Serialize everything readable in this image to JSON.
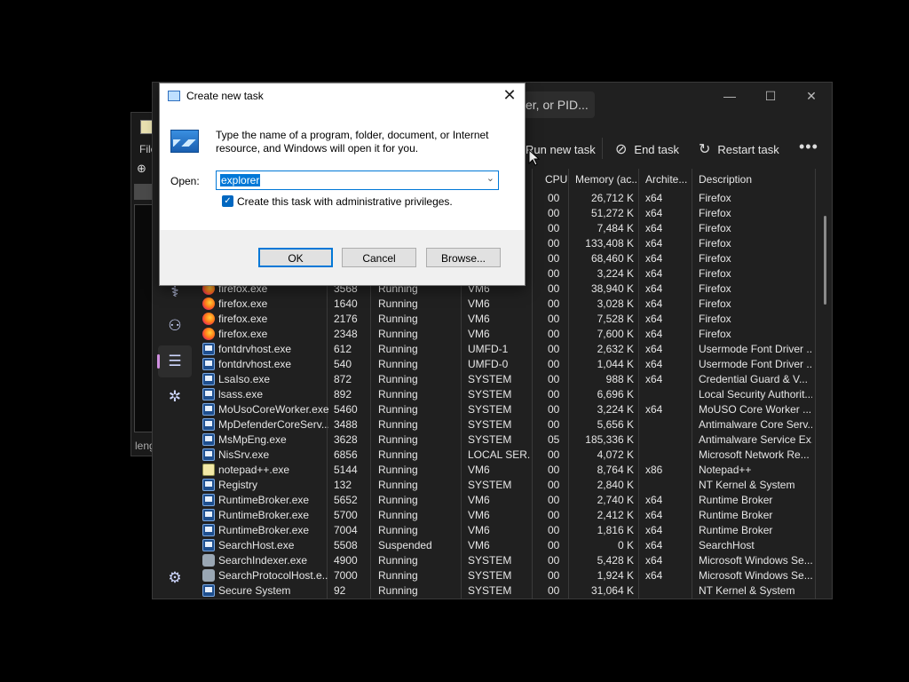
{
  "editor_window": {
    "menu_file": "File",
    "status_text": "leng"
  },
  "task_manager": {
    "search_placeholder": "er, or PID...",
    "window_controls": {
      "minimize": "—",
      "maximize": "☐",
      "close": "✕"
    },
    "commands": {
      "run_new_task": "Run new task",
      "end_task": "End task",
      "restart_task": "Restart task",
      "more": "•••"
    },
    "nav_icons": [
      "performance-icon",
      "users-icon",
      "details-icon",
      "services-icon",
      "settings-icon"
    ],
    "columns": {
      "cpu": "CPU",
      "memory": "Memory (ac...",
      "architecture": "Archite...",
      "description": "Description"
    },
    "top_rows": [
      {
        "cpu": "00",
        "mem": "26,712 K",
        "arch": "x64",
        "desc": "Firefox"
      },
      {
        "cpu": "00",
        "mem": "51,272 K",
        "arch": "x64",
        "desc": "Firefox"
      },
      {
        "cpu": "00",
        "mem": "7,484 K",
        "arch": "x64",
        "desc": "Firefox"
      },
      {
        "cpu": "00",
        "mem": "133,408 K",
        "arch": "x64",
        "desc": "Firefox"
      },
      {
        "cpu": "00",
        "mem": "68,460 K",
        "arch": "x64",
        "desc": "Firefox"
      },
      {
        "cpu": "00",
        "mem": "3,224 K",
        "arch": "x64",
        "desc": "Firefox"
      }
    ],
    "rows": [
      {
        "icon": "fox",
        "name": "firefox.exe",
        "pid": "3568",
        "status": "Running",
        "user": "VM6",
        "cpu": "00",
        "mem": "38,940 K",
        "arch": "x64",
        "desc": "Firefox"
      },
      {
        "icon": "fox",
        "name": "firefox.exe",
        "pid": "1640",
        "status": "Running",
        "user": "VM6",
        "cpu": "00",
        "mem": "3,028 K",
        "arch": "x64",
        "desc": "Firefox"
      },
      {
        "icon": "fox",
        "name": "firefox.exe",
        "pid": "2176",
        "status": "Running",
        "user": "VM6",
        "cpu": "00",
        "mem": "7,528 K",
        "arch": "x64",
        "desc": "Firefox"
      },
      {
        "icon": "fox",
        "name": "firefox.exe",
        "pid": "2348",
        "status": "Running",
        "user": "VM6",
        "cpu": "00",
        "mem": "7,600 K",
        "arch": "x64",
        "desc": "Firefox"
      },
      {
        "icon": "app",
        "name": "fontdrvhost.exe",
        "pid": "612",
        "status": "Running",
        "user": "UMFD-1",
        "cpu": "00",
        "mem": "2,632 K",
        "arch": "x64",
        "desc": "Usermode Font Driver ..."
      },
      {
        "icon": "app",
        "name": "fontdrvhost.exe",
        "pid": "540",
        "status": "Running",
        "user": "UMFD-0",
        "cpu": "00",
        "mem": "1,044 K",
        "arch": "x64",
        "desc": "Usermode Font Driver ..."
      },
      {
        "icon": "app",
        "name": "LsaIso.exe",
        "pid": "872",
        "status": "Running",
        "user": "SYSTEM",
        "cpu": "00",
        "mem": "988 K",
        "arch": "x64",
        "desc": "Credential Guard & V..."
      },
      {
        "icon": "app",
        "name": "lsass.exe",
        "pid": "892",
        "status": "Running",
        "user": "SYSTEM",
        "cpu": "00",
        "mem": "6,696 K",
        "arch": "",
        "desc": "Local Security Authorit..."
      },
      {
        "icon": "app",
        "name": "MoUsoCoreWorker.exe",
        "pid": "5460",
        "status": "Running",
        "user": "SYSTEM",
        "cpu": "00",
        "mem": "3,224 K",
        "arch": "x64",
        "desc": "MoUSO Core Worker ..."
      },
      {
        "icon": "app",
        "name": "MpDefenderCoreServ...",
        "pid": "3488",
        "status": "Running",
        "user": "SYSTEM",
        "cpu": "00",
        "mem": "5,656 K",
        "arch": "",
        "desc": "Antimalware Core Serv..."
      },
      {
        "icon": "app",
        "name": "MsMpEng.exe",
        "pid": "3628",
        "status": "Running",
        "user": "SYSTEM",
        "cpu": "05",
        "mem": "185,336 K",
        "arch": "",
        "desc": "Antimalware Service Ex..."
      },
      {
        "icon": "app",
        "name": "NisSrv.exe",
        "pid": "6856",
        "status": "Running",
        "user": "LOCAL SER...",
        "cpu": "00",
        "mem": "4,072 K",
        "arch": "",
        "desc": "Microsoft Network Re..."
      },
      {
        "icon": "note",
        "name": "notepad++.exe",
        "pid": "5144",
        "status": "Running",
        "user": "VM6",
        "cpu": "00",
        "mem": "8,764 K",
        "arch": "x86",
        "desc": "Notepad++"
      },
      {
        "icon": "app",
        "name": "Registry",
        "pid": "132",
        "status": "Running",
        "user": "SYSTEM",
        "cpu": "00",
        "mem": "2,840 K",
        "arch": "",
        "desc": "NT Kernel & System"
      },
      {
        "icon": "app",
        "name": "RuntimeBroker.exe",
        "pid": "5652",
        "status": "Running",
        "user": "VM6",
        "cpu": "00",
        "mem": "2,740 K",
        "arch": "x64",
        "desc": "Runtime Broker"
      },
      {
        "icon": "app",
        "name": "RuntimeBroker.exe",
        "pid": "5700",
        "status": "Running",
        "user": "VM6",
        "cpu": "00",
        "mem": "2,412 K",
        "arch": "x64",
        "desc": "Runtime Broker"
      },
      {
        "icon": "app",
        "name": "RuntimeBroker.exe",
        "pid": "7004",
        "status": "Running",
        "user": "VM6",
        "cpu": "00",
        "mem": "1,816 K",
        "arch": "x64",
        "desc": "Runtime Broker"
      },
      {
        "icon": "app",
        "name": "SearchHost.exe",
        "pid": "5508",
        "status": "Suspended",
        "user": "VM6",
        "cpu": "00",
        "mem": "0 K",
        "arch": "x64",
        "desc": "SearchHost"
      },
      {
        "icon": "user",
        "name": "SearchIndexer.exe",
        "pid": "4900",
        "status": "Running",
        "user": "SYSTEM",
        "cpu": "00",
        "mem": "5,428 K",
        "arch": "x64",
        "desc": "Microsoft Windows Se..."
      },
      {
        "icon": "user",
        "name": "SearchProtocolHost.e...",
        "pid": "7000",
        "status": "Running",
        "user": "SYSTEM",
        "cpu": "00",
        "mem": "1,924 K",
        "arch": "x64",
        "desc": "Microsoft Windows Se..."
      },
      {
        "icon": "app",
        "name": "Secure System",
        "pid": "92",
        "status": "Running",
        "user": "SYSTEM",
        "cpu": "00",
        "mem": "31,064 K",
        "arch": "",
        "desc": "NT Kernel & System"
      }
    ]
  },
  "dialog": {
    "title": "Create new task",
    "message": "Type the name of a program, folder, document, or Internet resource, and Windows will open it for you.",
    "open_label": "Open:",
    "open_value": "explorer",
    "admin_checkbox_label": "Create this task with administrative privileges.",
    "admin_checked": true,
    "ok_label": "OK",
    "cancel_label": "Cancel",
    "browse_label": "Browse..."
  }
}
